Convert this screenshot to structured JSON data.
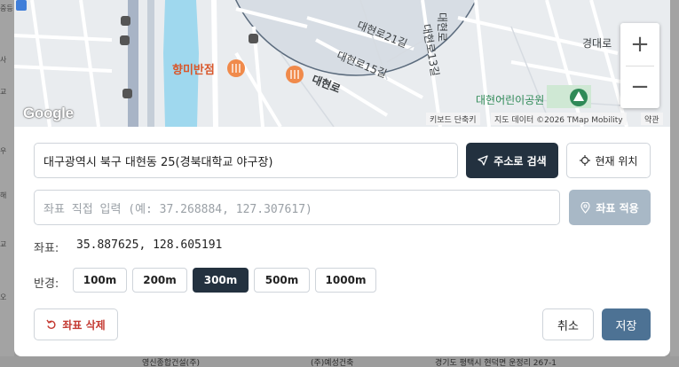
{
  "background": {
    "left_fragments": [
      "중등",
      "사",
      "교",
      "우",
      "해",
      "교",
      "오"
    ],
    "bottom_cells": [
      "영신종합건설(주)",
      "(주)예성건축",
      "경기도 평택시 현덕면 운정리 267-1"
    ]
  },
  "map": {
    "labels": {
      "road1": "대현로21길",
      "road2": "대현로15길",
      "road3": "대현로",
      "road4": "대현로13길",
      "road5": "대현로",
      "road6": "경대로"
    },
    "pois": {
      "restaurant": "향미반점",
      "park": "대현어린이공원"
    },
    "logo": "Google",
    "attribution": {
      "shortcuts": "키보드 단축키",
      "data": "지도 데이터 ©2026 TMap Mobility",
      "terms": "약관"
    },
    "zoom_in": "+",
    "zoom_out": "−"
  },
  "address": {
    "value": "대구광역시 북구 대현동 25(경북대학교 야구장)",
    "search_label": "주소로 검색",
    "current_location_label": "현재 위치"
  },
  "coord_input": {
    "placeholder": "좌표 직접 입력 (예: 37.268884, 127.307617)",
    "apply_label": "좌표 적용"
  },
  "coordinates": {
    "label": "좌표:",
    "value": "35.887625, 128.605191"
  },
  "radius": {
    "label": "반경:",
    "options": [
      "100m",
      "200m",
      "300m",
      "500m",
      "1000m"
    ],
    "selected": "300m"
  },
  "actions": {
    "delete_label": "좌표 삭제",
    "cancel_label": "취소",
    "save_label": "저장"
  },
  "colors": {
    "primary_dark": "#23313f",
    "save": "#4d7294",
    "disabled": "#a8b8c6",
    "danger": "#c43a32"
  }
}
